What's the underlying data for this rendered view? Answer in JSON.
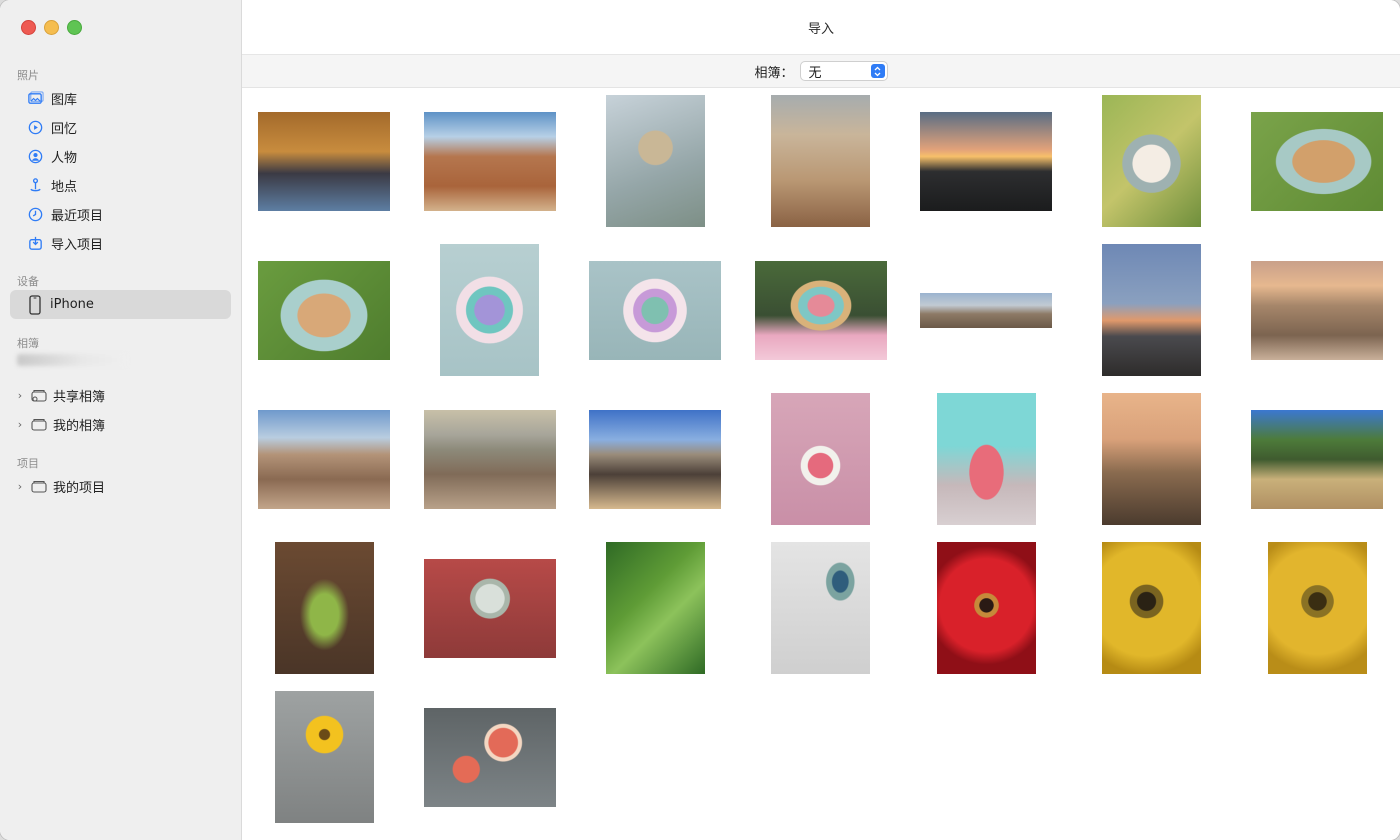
{
  "window": {
    "title": "导入"
  },
  "toolbar": {
    "album_label": "相簿：",
    "album_value": "无"
  },
  "sidebar": {
    "photos_header": "照片",
    "photos_items": [
      {
        "label": "图库",
        "icon": "photo-library-icon"
      },
      {
        "label": "回忆",
        "icon": "memories-icon"
      },
      {
        "label": "人物",
        "icon": "people-icon"
      },
      {
        "label": "地点",
        "icon": "places-icon"
      },
      {
        "label": "最近项目",
        "icon": "clock-icon"
      },
      {
        "label": "导入项目",
        "icon": "import-icon"
      }
    ],
    "devices_header": "设备",
    "device_name": "iPhone",
    "albums_header": "相簿",
    "album_groups": [
      {
        "label": "共享相簿",
        "icon": "shared-album-icon"
      },
      {
        "label": "我的相簿",
        "icon": "album-folder-icon"
      }
    ],
    "projects_header": "项目",
    "project_groups": [
      {
        "label": "我的项目",
        "icon": "project-folder-icon"
      }
    ]
  },
  "colors": {
    "accent": "#2f7cf6",
    "sidebar_bg": "#efefef",
    "selection_bg": "#d9d9d9",
    "close": "#ee5a52",
    "minimize": "#f5bd4f",
    "maximize": "#5fc453"
  },
  "photos": [
    {
      "name": "dog-on-rug",
      "shape": "landscape",
      "bg": "linear-gradient(180deg,#a36a2b 0%,#c88c3e 40%,#3b3a44 62%,#5d7ea3 100%)"
    },
    {
      "name": "desert-road",
      "shape": "landscape",
      "bg": "linear-gradient(180deg,#5e92c6 0%,#b7d0e6 25%,#b5764e 45%,#a9643b 75%,#d3b28c 100%)"
    },
    {
      "name": "plant-sky",
      "shape": "portrait",
      "bg": "radial-gradient(circle at 50% 40%,#c9b796 0 18%,transparent 19%),linear-gradient(160deg,#c7d2d9,#95a6a8 60%,#7d8f86)"
    },
    {
      "name": "rock-formation",
      "shape": "portrait",
      "bg": "linear-gradient(180deg,#a6acae 0%,#c9b59a 30%,#b99773 65%,#8a6244 100%)"
    },
    {
      "name": "sunset-hills",
      "shape": "landscape",
      "bg": "linear-gradient(180deg,#596d84 0%,#e2a27a 38%,#f7c06a 45%,#2d2e30 60%,#1b1c1d 100%)"
    },
    {
      "name": "pastry-plate-1",
      "shape": "portrait",
      "bg": "radial-gradient(circle at 50% 52%,#f4ede4 0 22%,#9eb1b1 23% 34%,transparent 35%),linear-gradient(135deg,#9bb656,#c3c46a 50%,#6f8f3c)"
    },
    {
      "name": "pastry-plate-2",
      "shape": "landscape",
      "bg": "radial-gradient(ellipse at 55% 50%,#d2a06b 0 30%,#a7c9c5 31% 46%,transparent 47%),linear-gradient(135deg,#7aa34a,#5f8b34)"
    },
    {
      "name": "pastry-plate-3",
      "shape": "landscape",
      "bg": "radial-gradient(ellipse at 50% 55%,#d8a878 0 28%,#a9cfcc 29% 46%,transparent 47%),linear-gradient(135deg,#6a9c3f,#4f7d2e)"
    },
    {
      "name": "macarons-plate-1",
      "shape": "portrait",
      "bg": "radial-gradient(circle at 50% 50%,#a394d8 0 18%,#6fc6c0 19% 28%,#f2dfe6 29% 40%,transparent 41%),linear-gradient(180deg,#b7cfd1,#a7c3c6)"
    },
    {
      "name": "macarons-plate-2",
      "shape": "landscape",
      "bg": "radial-gradient(circle at 50% 50%,#7fc0b0 0 16%,#c79ad8 17% 26%,#f4e4ea 27% 38%,transparent 39%),linear-gradient(180deg,#a9c3c7,#98b5b8)"
    },
    {
      "name": "macaron-tower",
      "shape": "landscape",
      "bg": "radial-gradient(ellipse at 50% 45%,#e58a98 0 14%,#7ec7c5 15% 24%,#d9b27a 25% 32%,transparent 33%),linear-gradient(180deg,#4a6a3a 0%,#3a4f33 55%,#e9a8c0 75%,#f3c9d8 100%)"
    },
    {
      "name": "panorama-mountains",
      "shape": "pano",
      "bg": "linear-gradient(180deg,#9bb3cf 0%,#c1cad2 35%,#8d7a66 60%,#6b5948 100%)"
    },
    {
      "name": "mountain-sunset",
      "shape": "portrait",
      "bg": "linear-gradient(180deg,#6e88b5 0%,#8aa0bf 45%,#e0996b 58%,#4a4a4e 70%,#2e2c2b 100%)"
    },
    {
      "name": "boulders-dusk",
      "shape": "landscape",
      "bg": "linear-gradient(180deg,#c9a08a 0%,#e6b88f 25%,#a6866a 45%,#7c6450 75%,#c9b09a 100%)"
    },
    {
      "name": "rocky-valley-1",
      "shape": "landscape",
      "bg": "linear-gradient(180deg,#6f99cc 0%,#b9cde0 28%,#b39378 45%,#8a6a52 70%,#c2a58a 100%)"
    },
    {
      "name": "rocky-valley-2",
      "shape": "landscape",
      "bg": "linear-gradient(180deg,#c8c0a8 0%,#a7a59a 25%,#8d8a7a 40%,#806b58 65%,#b8a189 100%)"
    },
    {
      "name": "rock-arch",
      "shape": "landscape",
      "bg": "linear-gradient(180deg,#3f72c7 0%,#89aee0 30%,#9a8c7a 45%,#4c4038 65%,#d6b98f 100%)"
    },
    {
      "name": "pink-table-dessert",
      "shape": "portrait",
      "bg": "radial-gradient(circle at 50% 55%,#e56a7d 0 14%,#f2f1ec 15% 22%,transparent 23%),linear-gradient(180deg,#d7a6b8,#c98fa7)"
    },
    {
      "name": "pink-cake",
      "shape": "portrait",
      "bg": "radial-gradient(ellipse at 50% 60%,#e86c7a 0 24%,transparent 25%),linear-gradient(180deg,#7ed7d6 0%,#7ed7d6 40%,#c6b8ba 70%,#d8cfd1 100%)"
    },
    {
      "name": "wild-grass-sunset",
      "shape": "portrait",
      "bg": "linear-gradient(180deg,#e8b48a 0%,#d9a17a 35%,#8a6b4f 60%,#4b3b2e 100%)"
    },
    {
      "name": "dry-grass-trees",
      "shape": "landscape",
      "bg": "linear-gradient(180deg,#3b78d1 0%,#4d7b3a 30%,#3f5b2f 50%,#c9b07a 70%,#b09063 100%)"
    },
    {
      "name": "green-plant-dark",
      "shape": "portrait",
      "bg": "radial-gradient(ellipse at 50% 55%,#8fb648 0 20%,transparent 35%),linear-gradient(180deg,#6b4a32,#4a3527)"
    },
    {
      "name": "allium-flower",
      "shape": "landscape",
      "bg": "radial-gradient(circle at 50% 40%,#d9e0da 0 16%,#a9b6aa 17% 22%,transparent 23%),linear-gradient(180deg,#b74a48,#8e3a39)"
    },
    {
      "name": "green-leaf",
      "shape": "portrait",
      "bg": "linear-gradient(135deg,#2f6a25 0%,#5f9c36 40%,#8cc25b 60%,#2f6a25 100%)"
    },
    {
      "name": "peacock-feather",
      "shape": "portrait",
      "bg": "radial-gradient(ellipse at 70% 30%,#2f5d7c 0 8%,#7ba3a0 9% 14%,transparent 15%),linear-gradient(180deg,#e4e4e4,#cfcfcf)"
    },
    {
      "name": "red-gerbera",
      "shape": "portrait",
      "bg": "radial-gradient(circle at 50% 48%,#2a1a14 0 8%,#c68a3a 9% 14%,#d9212a 15% 55%,#8f0f17 70%)"
    },
    {
      "name": "yellow-gerbera-1",
      "shape": "portrait",
      "bg": "radial-gradient(circle at 45% 45%,#2a2214 0 10%,#7a6420 11% 18%,#e1b72a 19% 60%,#b68b14 80%)"
    },
    {
      "name": "yellow-gerbera-2",
      "shape": "portrait",
      "bg": "radial-gradient(circle at 50% 45%,#3a2e12 0 10%,#8a7224 11% 18%,#e2b52d 19% 60%,#b98d18 80%)"
    },
    {
      "name": "yellow-flower-stem",
      "shape": "portrait",
      "bg": "radial-gradient(circle at 50% 33%,#6b4b17 0 5%,#f3c21f 6% 18%,transparent 19%),linear-gradient(180deg,#9ea2a2,#7f8282)"
    },
    {
      "name": "grapefruit",
      "shape": "landscape",
      "bg": "radial-gradient(circle at 60% 35%,#e36a58 0 14%,#f4d7c2 15% 18%,transparent 19%),radial-gradient(circle at 32% 62%,#e46b56 0 12%,transparent 13%),linear-gradient(180deg,#5e6466,#7d8487)"
    }
  ]
}
